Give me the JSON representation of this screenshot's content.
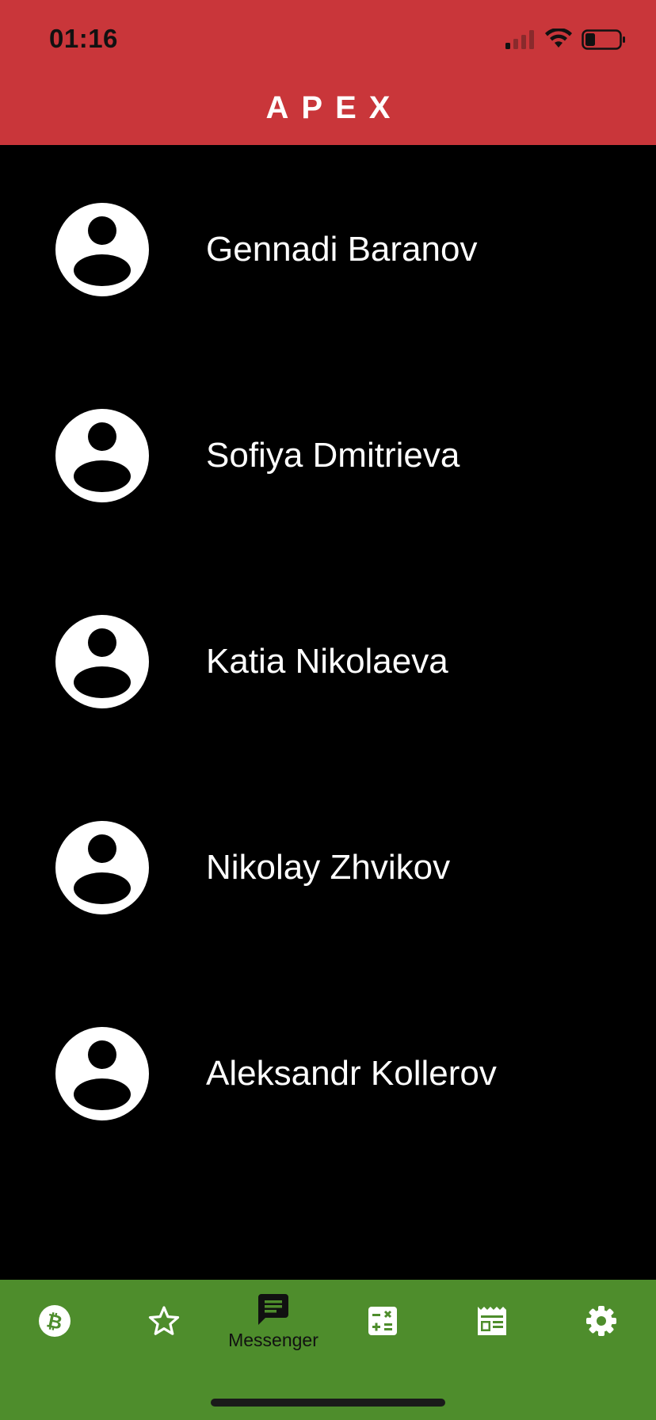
{
  "status_bar": {
    "time": "01:16",
    "icons": [
      "signal-icon",
      "wifi-icon",
      "battery-icon"
    ]
  },
  "header": {
    "title": "APEX",
    "background": "#C9363A"
  },
  "contacts": [
    {
      "name": "Gennadi Baranov",
      "avatar": "person-icon"
    },
    {
      "name": "Sofiya Dmitrieva",
      "avatar": "person-icon"
    },
    {
      "name": "Katia Nikolaeva",
      "avatar": "person-icon"
    },
    {
      "name": "Nikolay Zhvikov",
      "avatar": "person-icon"
    },
    {
      "name": "Aleksandr Kollerov",
      "avatar": "person-icon"
    }
  ],
  "tabbar": {
    "background": "#4E8D2C",
    "tabs": [
      {
        "icon": "bitcoin-icon",
        "label": ""
      },
      {
        "icon": "star-icon",
        "label": ""
      },
      {
        "icon": "message-icon",
        "label": "Messenger",
        "active": true
      },
      {
        "icon": "calculator-icon",
        "label": ""
      },
      {
        "icon": "news-icon",
        "label": ""
      },
      {
        "icon": "gear-icon",
        "label": ""
      }
    ]
  }
}
